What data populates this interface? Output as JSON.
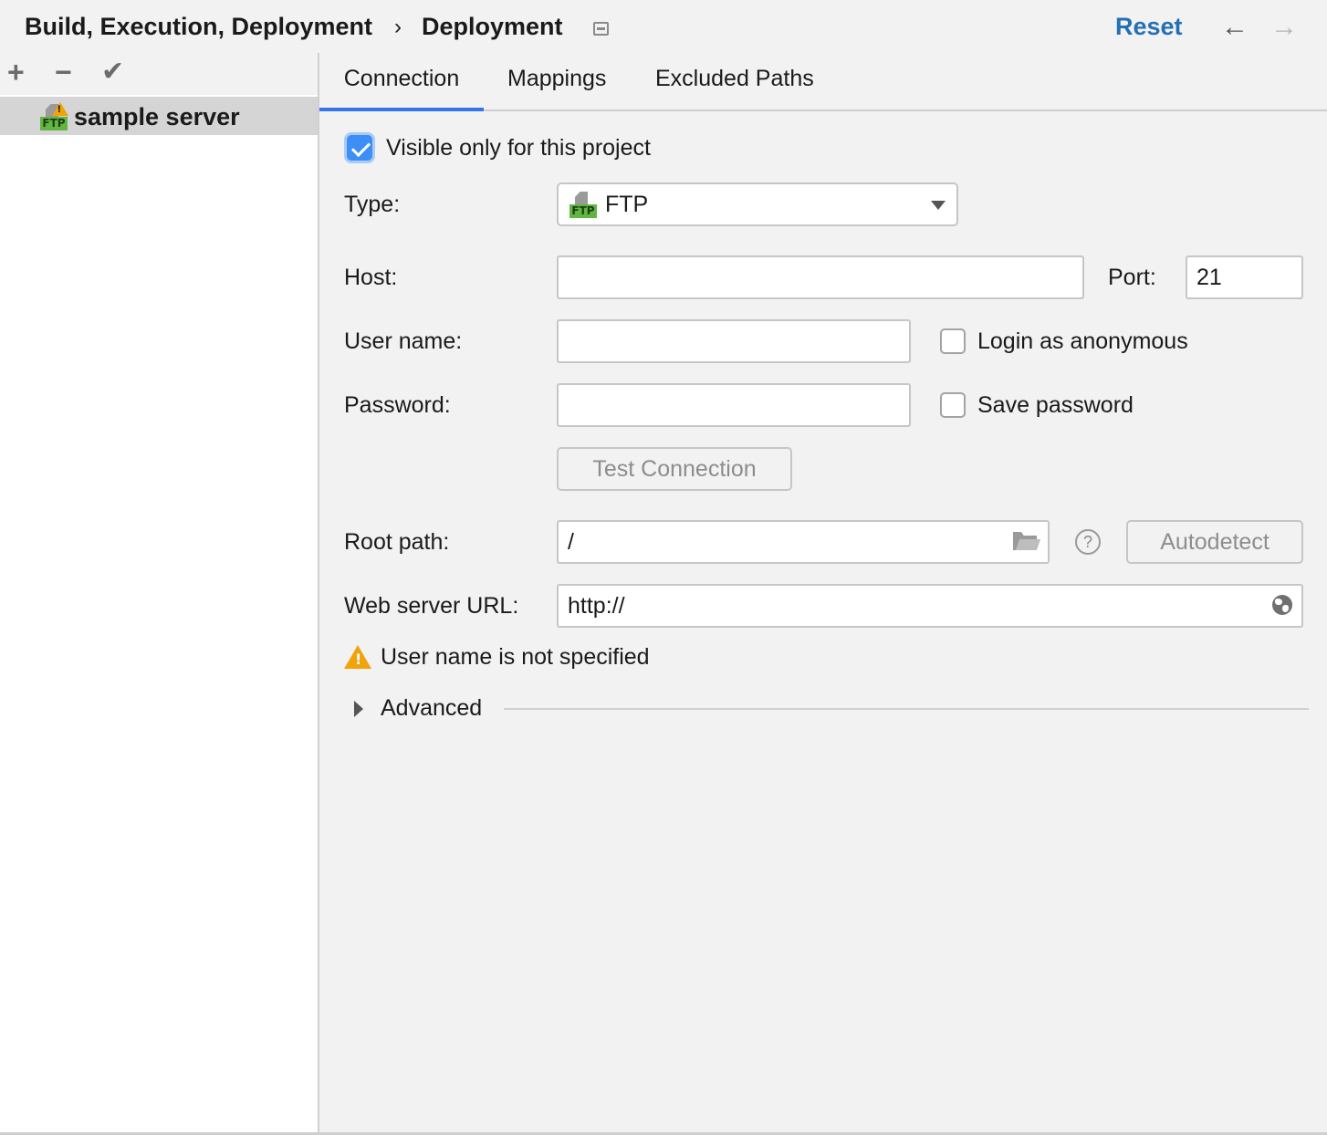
{
  "header": {
    "breadcrumb": [
      "Build, Execution, Deployment",
      "Deployment"
    ],
    "separator": "›",
    "reset_label": "Reset",
    "back_icon": "←",
    "forward_icon": "→"
  },
  "sidebar": {
    "toolbar": {
      "add_icon": "+",
      "remove_icon": "−",
      "apply_icon": "✔"
    },
    "servers": [
      {
        "name": "sample server",
        "type_icon": "FTP",
        "has_warning": true,
        "selected": true
      }
    ]
  },
  "tabs": [
    {
      "label": "Connection",
      "active": true
    },
    {
      "label": "Mappings",
      "active": false
    },
    {
      "label": "Excluded Paths",
      "active": false
    }
  ],
  "form": {
    "visible_only_label": "Visible only for this project",
    "visible_only_checked": true,
    "type_label": "Type:",
    "type_value": "FTP",
    "type_icon_text": "FTP",
    "host_label": "Host:",
    "host_value": "",
    "port_label": "Port:",
    "port_value": "21",
    "username_label": "User name:",
    "username_value": "",
    "login_anonymous_label": "Login as anonymous",
    "login_anonymous_checked": false,
    "password_label": "Password:",
    "password_value": "",
    "save_password_label": "Save password",
    "save_password_checked": false,
    "test_connection_label": "Test Connection",
    "root_path_label": "Root path:",
    "root_path_value": "/",
    "help_icon": "?",
    "autodetect_label": "Autodetect",
    "web_url_label": "Web server URL:",
    "web_url_value": "http://",
    "warning_text": "User name is not specified",
    "advanced_label": "Advanced"
  },
  "colors": {
    "accent": "#3574f0",
    "link": "#2470b3",
    "warning": "#f0a30a",
    "ftp_badge": "#62b543",
    "selection": "#d5d5d5"
  }
}
